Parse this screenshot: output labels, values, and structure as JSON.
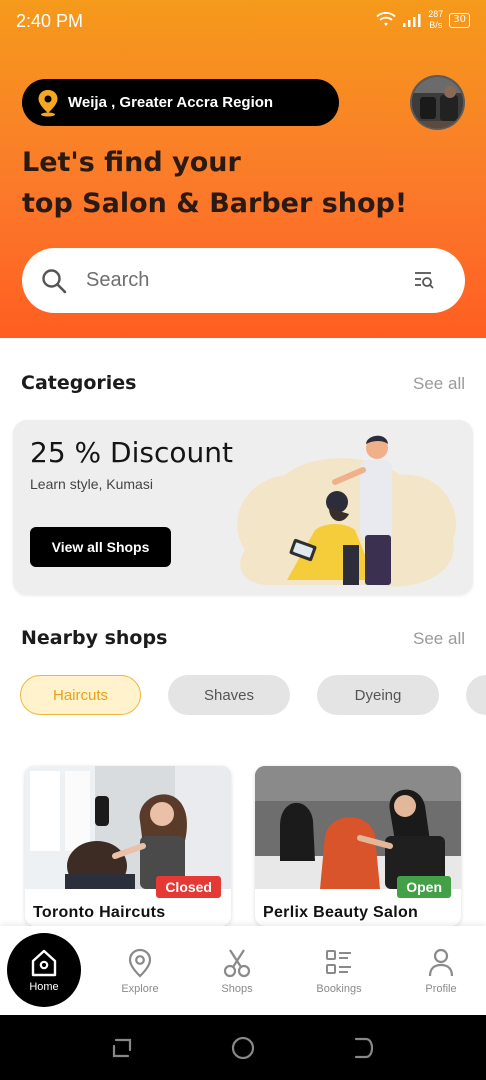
{
  "status_bar": {
    "time": "2:40 PM",
    "speed_value": "287",
    "speed_unit": "B/s",
    "battery": "30"
  },
  "header": {
    "location": "Weija , Greater Accra Region",
    "headline_line1": "Let's find your",
    "headline_line2": "top Salon & Barber shop!"
  },
  "search": {
    "placeholder": "Search"
  },
  "categories": {
    "title": "Categories",
    "see_all": "See all"
  },
  "promo": {
    "title": "25 % Discount",
    "subtitle": "Learn style, Kumasi",
    "button": "View all Shops"
  },
  "nearby": {
    "title": "Nearby shops",
    "see_all": "See all",
    "chips": [
      {
        "label": "Haircuts",
        "active": true
      },
      {
        "label": "Shaves",
        "active": false
      },
      {
        "label": "Dyeing",
        "active": false
      }
    ],
    "shops": [
      {
        "name": "Toronto Haircuts",
        "status": "Closed",
        "status_color": "#e53935"
      },
      {
        "name": "Perlix Beauty Salon",
        "status": "Open",
        "status_color": "#43a047"
      }
    ]
  },
  "bottom_nav": {
    "items": [
      {
        "label": "Home",
        "icon": "home-icon",
        "active": true
      },
      {
        "label": "Explore",
        "icon": "location-pin-icon"
      },
      {
        "label": "Shops",
        "icon": "scissors-icon"
      },
      {
        "label": "Bookings",
        "icon": "list-icon"
      },
      {
        "label": "Profile",
        "icon": "person-icon"
      }
    ]
  },
  "colors": {
    "accent_orange": "#ff6a1f",
    "accent_yellow": "#f0b73b",
    "closed_red": "#e53935",
    "open_green": "#43a047"
  }
}
